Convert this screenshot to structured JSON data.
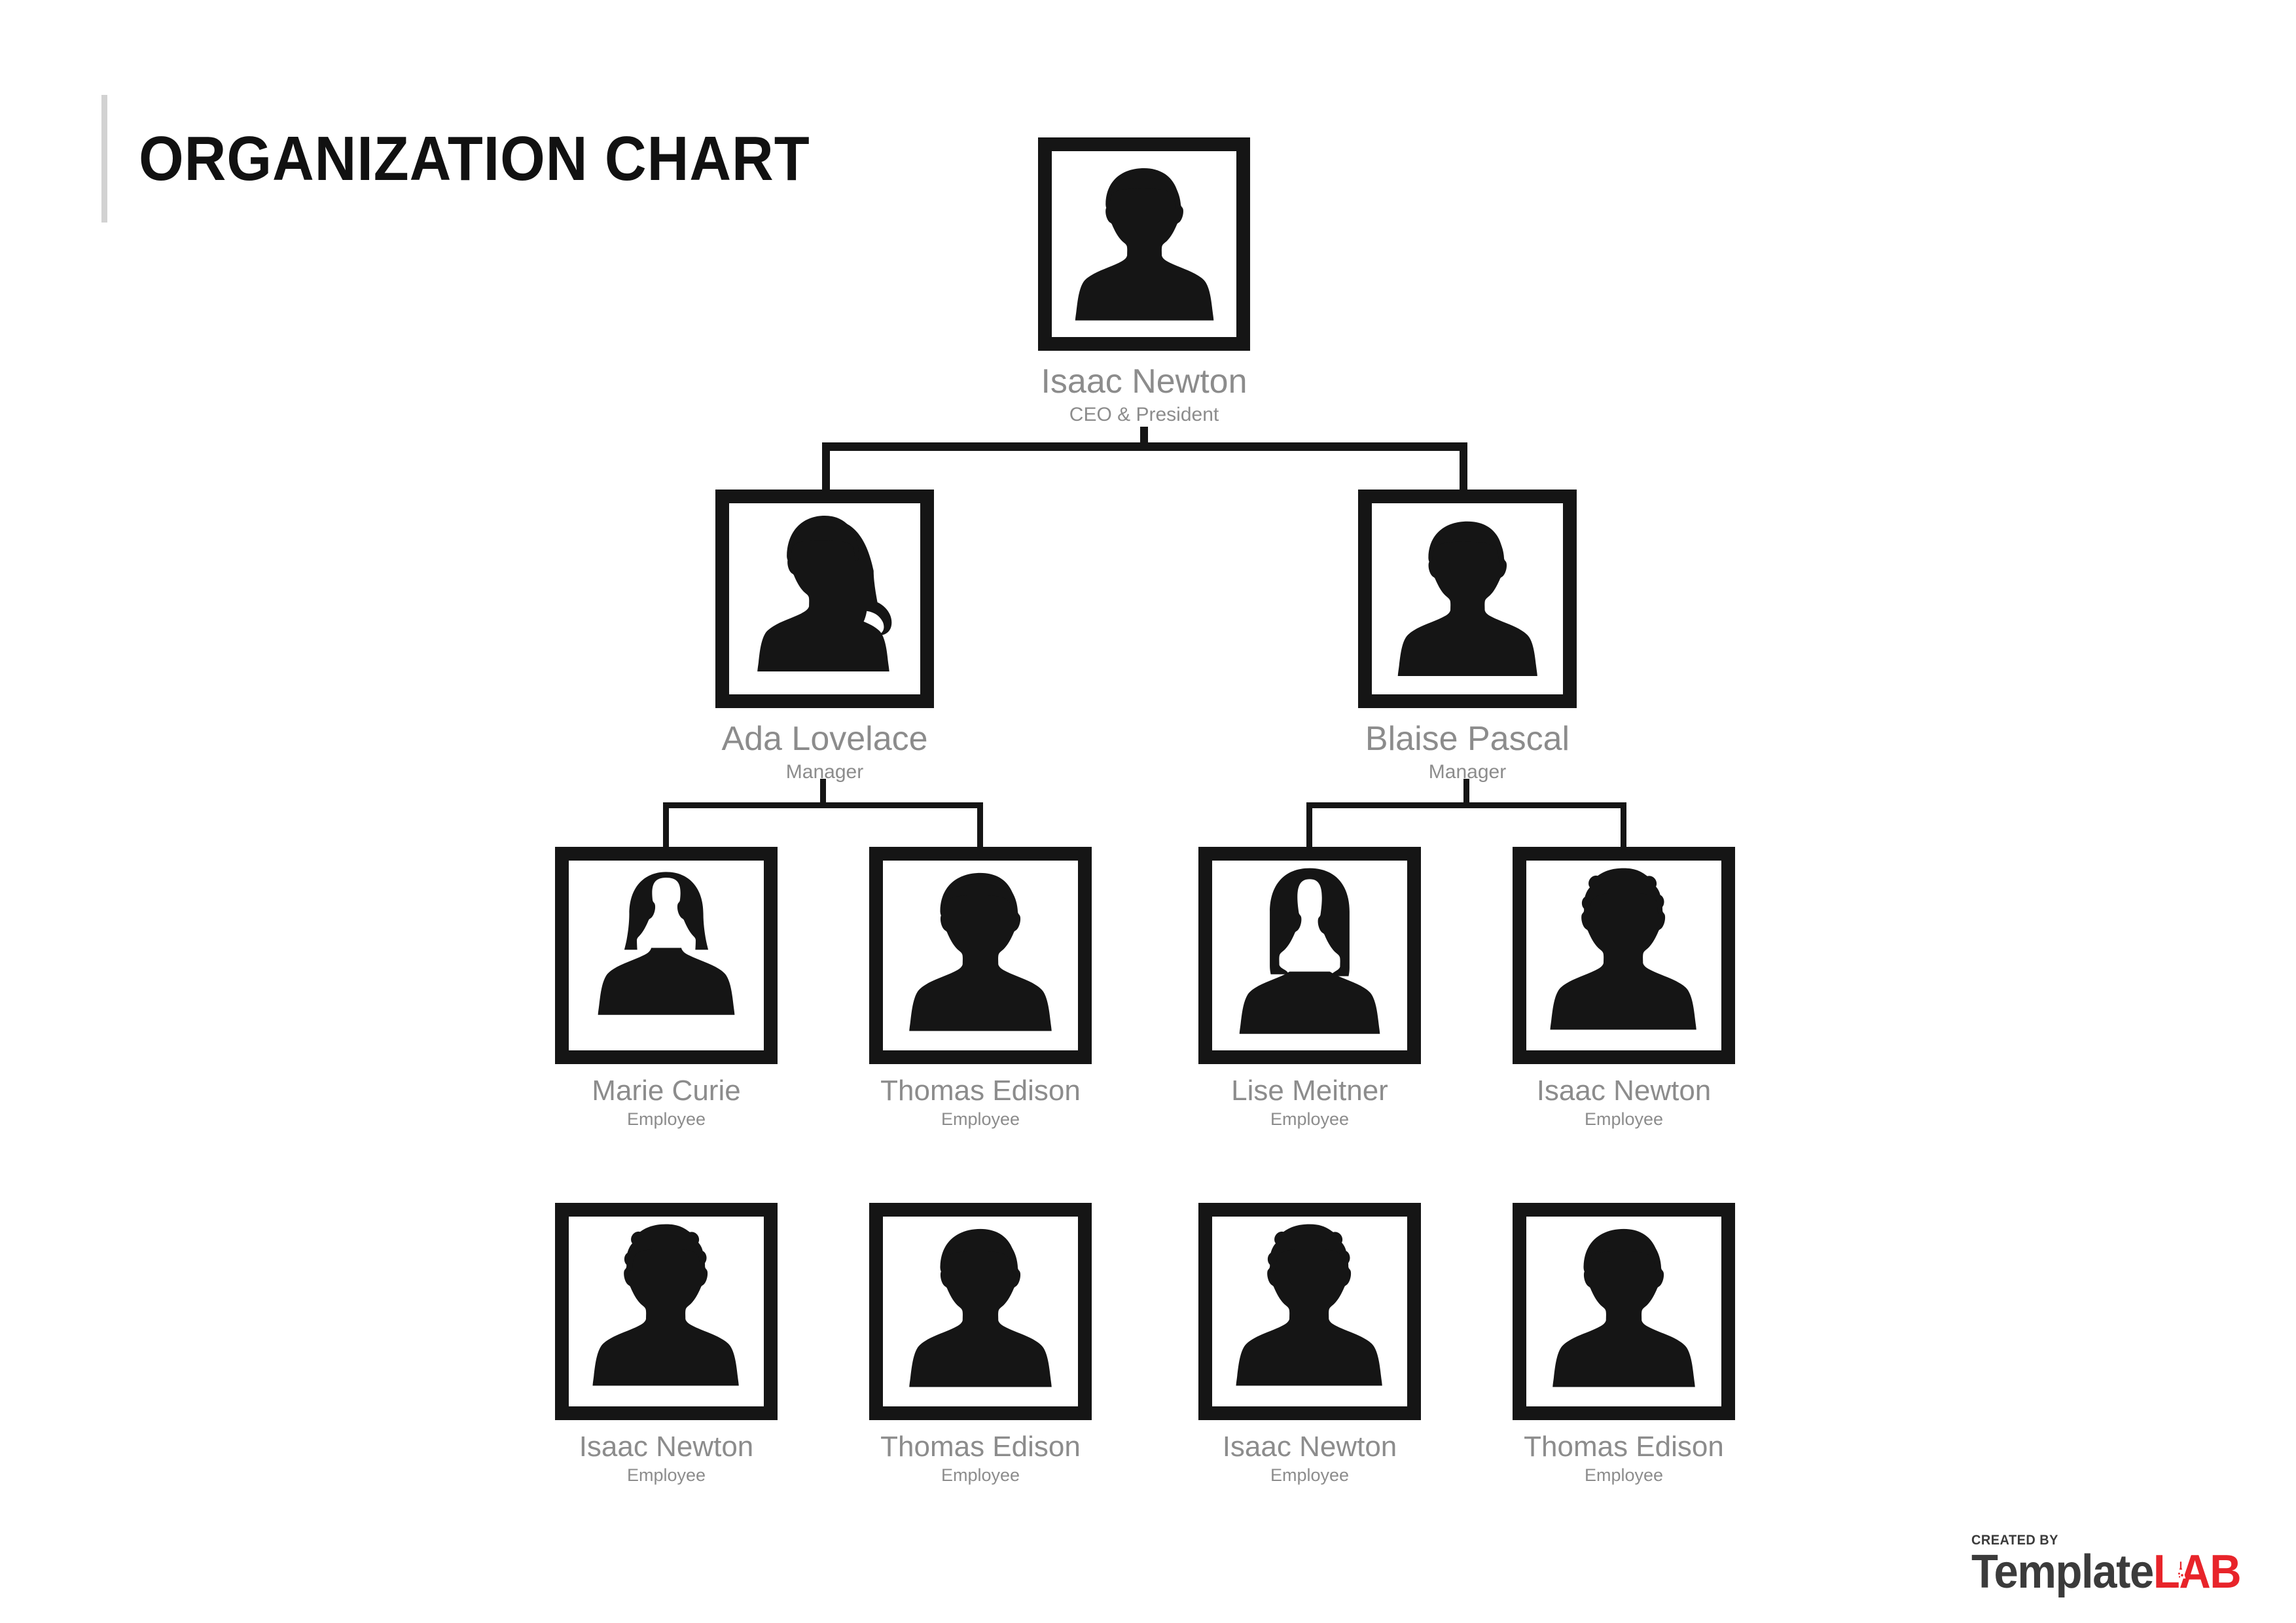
{
  "page": {
    "title": "ORGANIZATION CHART",
    "background_color": "#ffffff",
    "accent_bar_color": "#d2d2d2",
    "frame_color": "#151515",
    "text_color": "#8c8c8c",
    "connector_color": "#151515"
  },
  "chart_data": {
    "type": "diagram",
    "title": "ORGANIZATION CHART",
    "levels": 3,
    "nodes": [
      {
        "id": "ceo",
        "level": 1,
        "name": "Isaac Newton",
        "role": "CEO & President",
        "avatar": "male-curly-silhouette",
        "parent": null
      },
      {
        "id": "mgr-left",
        "level": 2,
        "name": "Ada Lovelace",
        "role": "Manager",
        "avatar": "female-ponytail-silhouette",
        "parent": "ceo"
      },
      {
        "id": "mgr-right",
        "level": 2,
        "name": "Blaise Pascal",
        "role": "Manager",
        "avatar": "male-short-silhouette",
        "parent": "ceo"
      },
      {
        "id": "emp-1",
        "level": 3,
        "name": "Marie Curie",
        "role": "Employee",
        "avatar": "female-bob-silhouette",
        "parent": "mgr-left"
      },
      {
        "id": "emp-2",
        "level": 3,
        "name": "Thomas Edison",
        "role": "Employee",
        "avatar": "male-short-silhouette",
        "parent": "mgr-left"
      },
      {
        "id": "emp-3",
        "level": 3,
        "name": "Lise Meitner",
        "role": "Employee",
        "avatar": "female-long-hair-silhouette",
        "parent": "mgr-right"
      },
      {
        "id": "emp-4",
        "level": 3,
        "name": "Isaac Newton",
        "role": "Employee",
        "avatar": "male-curly-silhouette",
        "parent": "mgr-right"
      },
      {
        "id": "emp-5",
        "level": 3,
        "name": "Isaac Newton",
        "role": "Employee",
        "avatar": "male-curly-silhouette",
        "parent": null
      },
      {
        "id": "emp-6",
        "level": 3,
        "name": "Thomas Edison",
        "role": "Employee",
        "avatar": "male-short-silhouette",
        "parent": null
      },
      {
        "id": "emp-7",
        "level": 3,
        "name": "Isaac Newton",
        "role": "Employee",
        "avatar": "male-curly-silhouette",
        "parent": null
      },
      {
        "id": "emp-8",
        "level": 3,
        "name": "Thomas Edison",
        "role": "Employee",
        "avatar": "male-short-silhouette",
        "parent": null
      }
    ]
  },
  "footer": {
    "created_by": "CREATED BY",
    "brand_template": "Template",
    "brand_lab": "LAB",
    "brand_dark_color": "#3b3b3b",
    "brand_red_color": "#e8242a"
  }
}
